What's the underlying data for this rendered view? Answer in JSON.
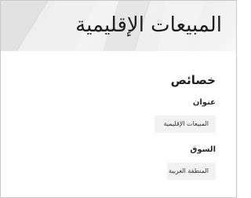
{
  "header": {
    "title": "المبيعات الإقليمية"
  },
  "properties": {
    "section_title": "خصائص",
    "fields": [
      {
        "label": "عنوان",
        "value": "المبيعات الإقليمية"
      },
      {
        "label": "السوق",
        "value": "المنطقة الغربية"
      }
    ]
  }
}
